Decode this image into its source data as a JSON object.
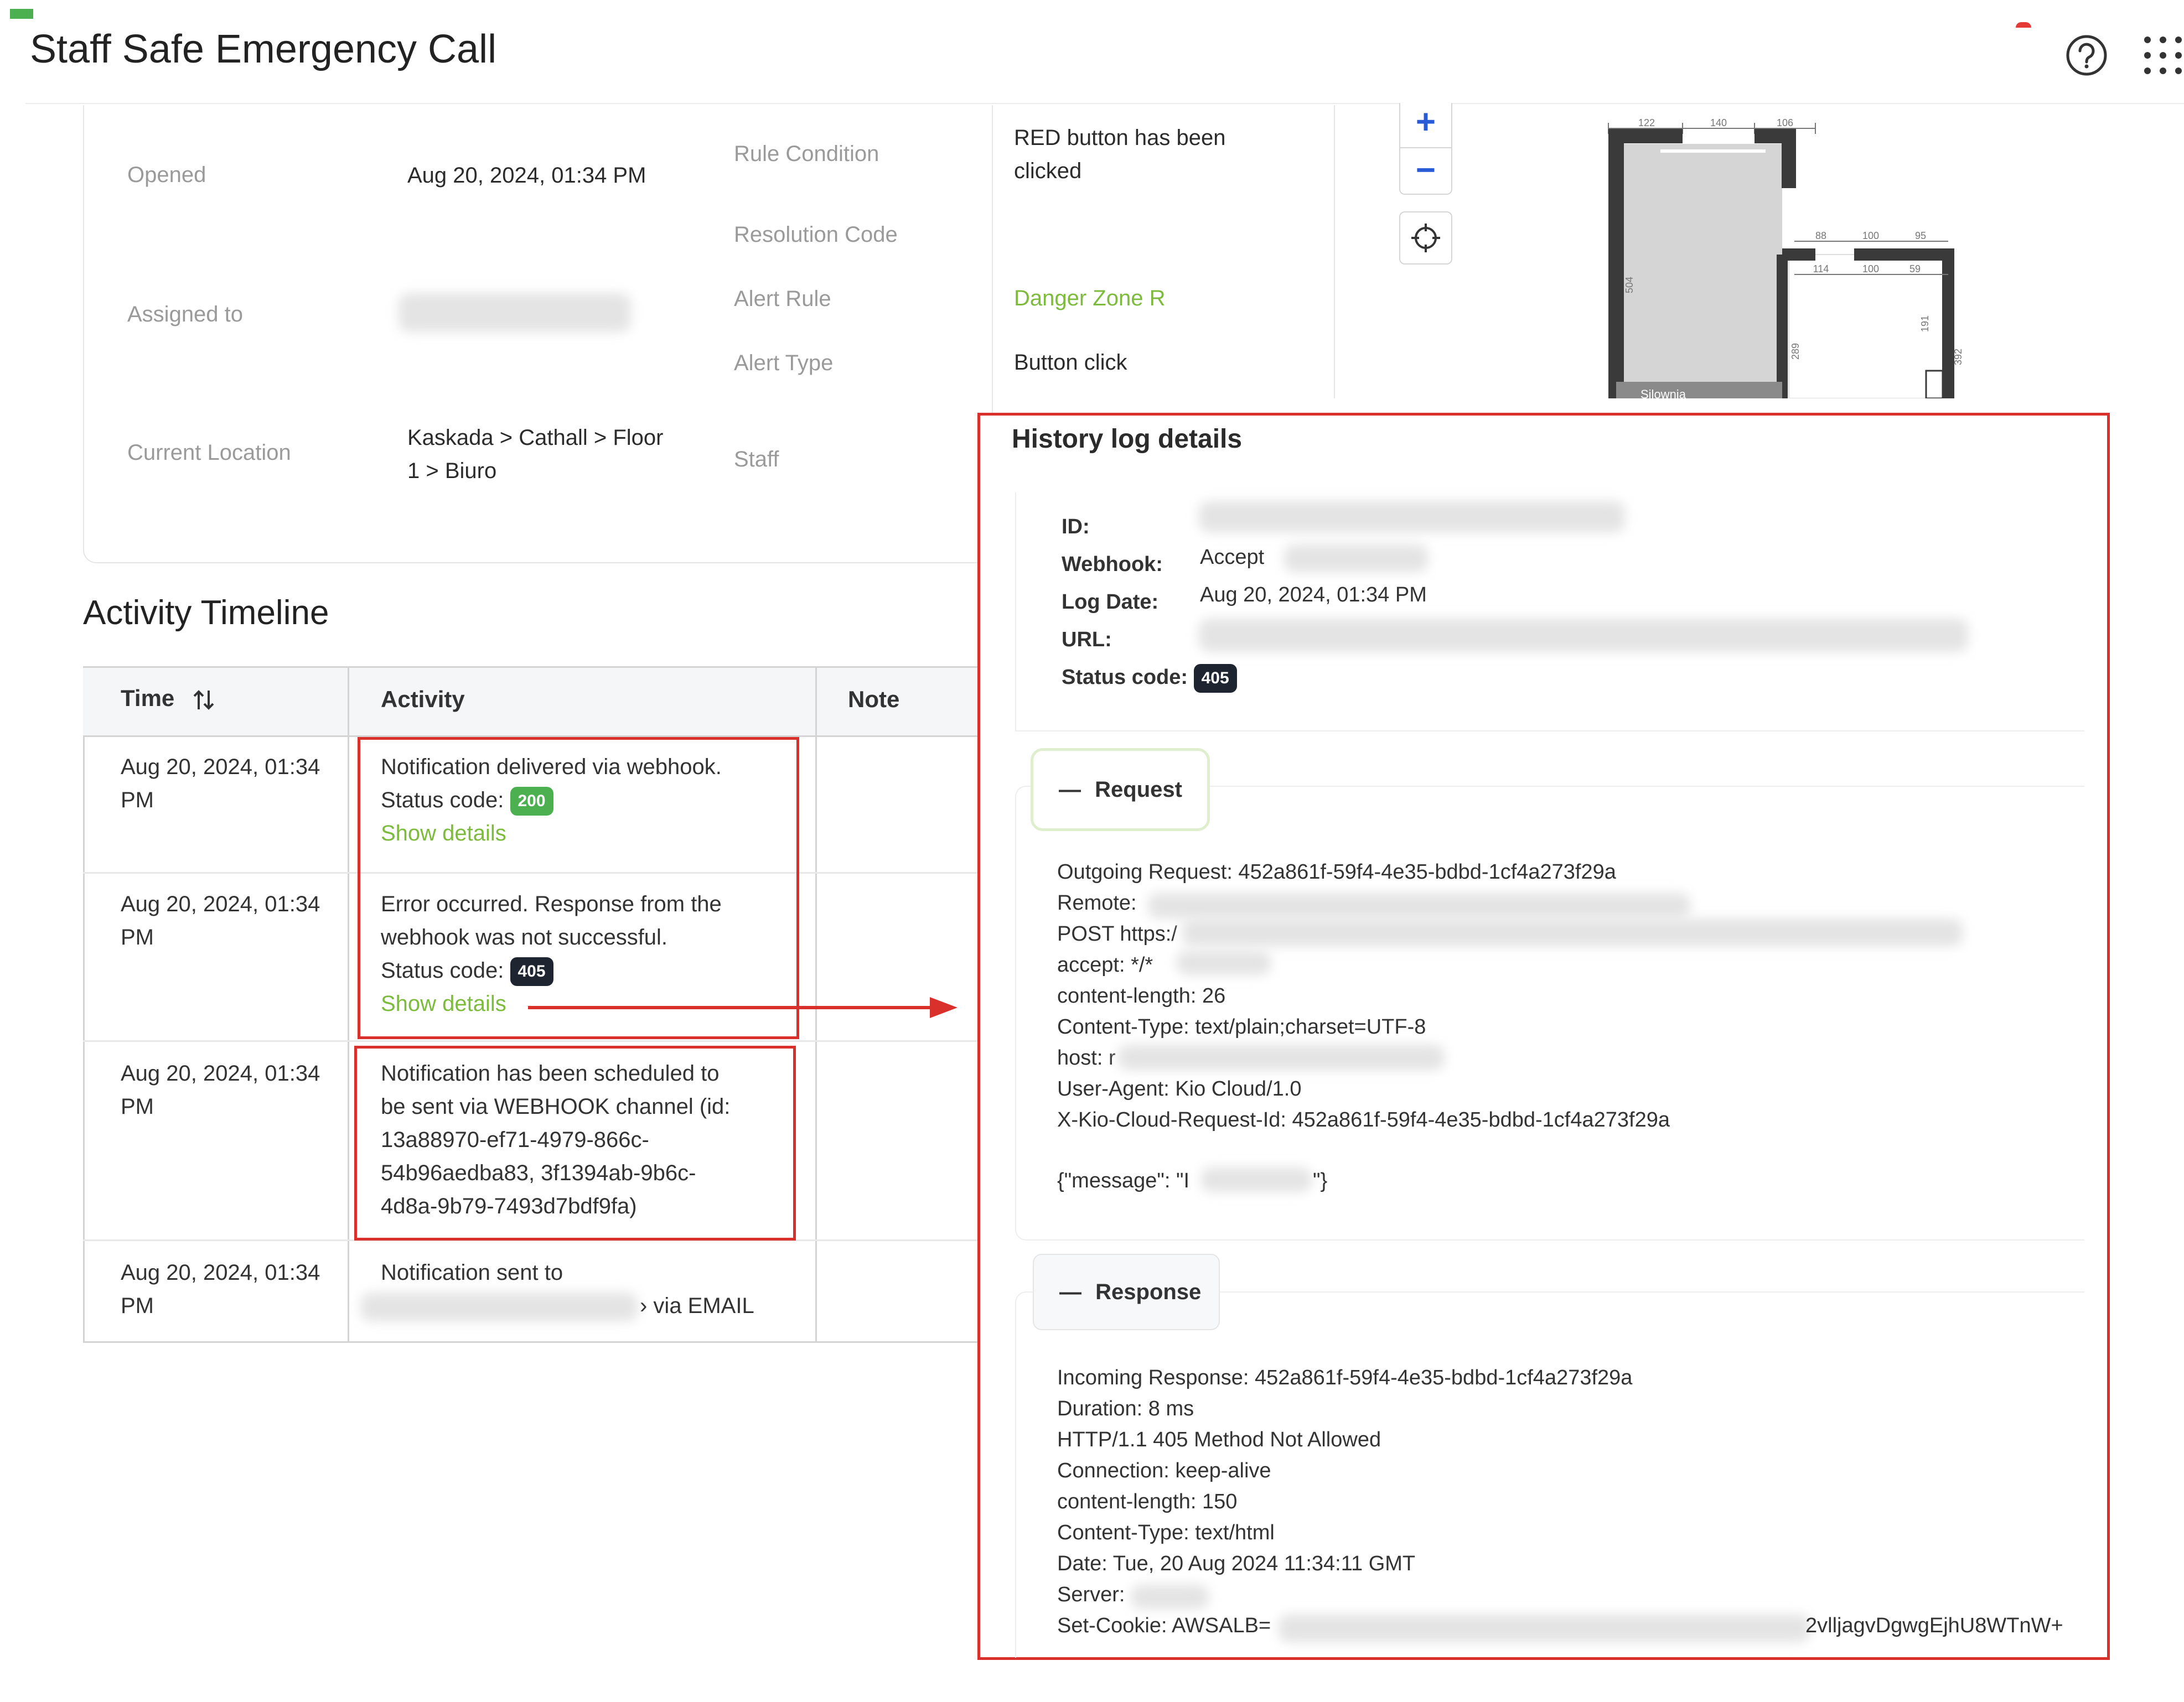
{
  "page": {
    "title": "Staff Safe Emergency Call",
    "help_icon": "help-circle-icon",
    "apps_icon": "grid-dots-icon"
  },
  "details": {
    "opened_label": "Opened",
    "opened_value": "Aug 20, 2024, 01:34 PM",
    "assigned_label": "Assigned to",
    "location_label": "Current Location",
    "location_line1": "Kaskada > Cathall > Floor",
    "location_line2": "1 > Biuro",
    "rule_condition_label": "Rule Condition",
    "rule_condition_line1": "RED button has been",
    "rule_condition_line2": "clicked",
    "resolution_label": "Resolution Code",
    "alert_rule_label": "Alert Rule",
    "alert_rule_value": "Danger Zone R",
    "alert_type_label": "Alert Type",
    "alert_type_value": "Button click",
    "staff_label": "Staff"
  },
  "map": {
    "zoom_in": "+",
    "zoom_out": "−",
    "dims_top": [
      "122",
      "140",
      "106"
    ],
    "dims_right": [
      "88",
      "100",
      "95"
    ],
    "dims_lower": [
      "114",
      "100",
      "59"
    ],
    "dim_side_left": "504",
    "dim_side_mid": "289",
    "dim_side_right": "191",
    "dim_side_far": "392",
    "room_label": "Silownia"
  },
  "timeline": {
    "title": "Activity Timeline",
    "col_time": "Time",
    "col_activity": "Activity",
    "col_note": "Note",
    "rows": [
      {
        "time1": "Aug 20, 2024, 01:34",
        "time2": "PM",
        "text1": "Notification delivered via webhook.",
        "status_label": "Status code:",
        "status": "200",
        "link": "Show details"
      },
      {
        "time1": "Aug 20, 2024, 01:34",
        "time2": "PM",
        "text1": "Error occurred. Response from the",
        "text2": "webhook was not successful.",
        "status_label": "Status code:",
        "status": "405",
        "link": "Show details"
      },
      {
        "time1": "Aug 20, 2024, 01:34",
        "time2": "PM",
        "text1": "Notification has been scheduled to",
        "text2": "be sent via WEBHOOK channel (id:",
        "text3": "13a88970-ef71-4979-866c-",
        "text4": "54b96aedba83, 3f1394ab-9b6c-",
        "text5": "4d8a-9b79-7493d7bdf9fa)"
      },
      {
        "time1": "Aug 20, 2024, 01:34",
        "time2": "PM",
        "text1": "Notification sent to",
        "text2": "› via EMAIL"
      }
    ]
  },
  "history": {
    "title": "History log details",
    "id_label": "ID:",
    "webhook_label": "Webhook:",
    "webhook_value": "Accept",
    "logdate_label": "Log Date:",
    "logdate_value": "Aug 20, 2024, 01:34 PM",
    "url_label": "URL:",
    "status_label": "Status code:",
    "status_value": "405",
    "request_title": "Request",
    "request_lines": [
      "Outgoing Request: 452a861f-59f4-4e35-bdbd-1cf4a273f29a",
      "Remote:",
      "POST https:/",
      "accept: */*",
      "content-length: 26",
      "Content-Type: text/plain;charset=UTF-8",
      "host: r",
      "User-Agent: Kio Cloud/1.0",
      "X-Kio-Cloud-Request-Id: 452a861f-59f4-4e35-bdbd-1cf4a273f29a"
    ],
    "request_body_start": "{\"message\": \"I",
    "request_body_end": "\"}",
    "response_title": "Response",
    "response_lines": [
      "Incoming Response: 452a861f-59f4-4e35-bdbd-1cf4a273f29a",
      "Duration: 8 ms",
      "HTTP/1.1 405 Method Not Allowed",
      "Connection: keep-alive",
      "content-length: 150",
      "Content-Type: text/html",
      "Date: Tue, 20 Aug 2024 11:34:11 GMT",
      "Server:",
      "Set-Cookie: AWSALB="
    ],
    "cookie_tail": "2vlljagvDgwgEjhU8WTnW+"
  },
  "colors": {
    "accent_green": "#7cbb3b",
    "annotation_red": "#d9302c",
    "badge_dark": "#1e2530",
    "badge_green": "#4caf50"
  }
}
